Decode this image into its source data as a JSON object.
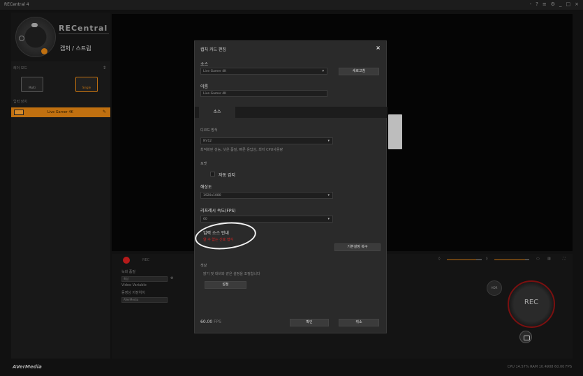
{
  "window": {
    "title": "RECentral 4",
    "controls": [
      "-",
      "?",
      "≡",
      "⚙",
      "_",
      "□",
      "×"
    ]
  },
  "sidebar": {
    "brand": "RECentral",
    "mode_label": "캡처 / 스트림",
    "section_mode": "레이 모드",
    "mode_buttons": [
      "Multi",
      "Single"
    ],
    "section_sources": "입력 장치",
    "source_item": "Live Gamer 4K",
    "collapse": "⇕"
  },
  "bottom": {
    "rec_tab": "REC",
    "label_a": "녹화 품질",
    "value_a": "최상",
    "value_b": "Video Variable",
    "label_c": "동영상 저장위치",
    "value_c": "AVerMedia",
    "side_button": "HDR",
    "rec_label": "REC",
    "slider_icons": [
      "◊",
      "◊",
      "▭",
      "▥",
      "⛶"
    ]
  },
  "dialog": {
    "title": "캡처 카드 편집",
    "close": "×",
    "source_label": "소스",
    "source_value": "Live Gamer 4K",
    "refresh_button": "새로고침",
    "name_label": "이름",
    "name_value": "Live Gamer 4K",
    "tab_source": "소스",
    "decode_label": "디코드 방식",
    "decode_value": "NV12",
    "decode_hint": "최적화된 성능, 낮은 품질, 빠른 응답성, 최저 CPU사용량",
    "format_label": "포맷",
    "auto_detect": "자동 감지",
    "resolution_label": "해상도",
    "resolution_value": "1920x1080",
    "refresh_rate_label": "리프레시 속도(FPS)",
    "refresh_rate_value": "60",
    "input_guide_label": "입력 소스 안내",
    "input_guide_note": "알 수 없는 신호 형식",
    "defaults_button": "기본설정 복구",
    "color_label": "색상",
    "color_hint": "밝기 및 대비와 같은 설정을 조정합니다",
    "settings_button": "설정",
    "fps_value": "60.00",
    "fps_unit": "FPS",
    "ok_button": "확인",
    "cancel_button": "취소"
  },
  "status": {
    "logo": "AVerMedia",
    "stats": "CPU 14.57%  RAM 10.4908  60.00 FPS"
  },
  "colors": {
    "accent": "#c07010",
    "rec": "#b51a1a",
    "warning": "#d42222"
  }
}
